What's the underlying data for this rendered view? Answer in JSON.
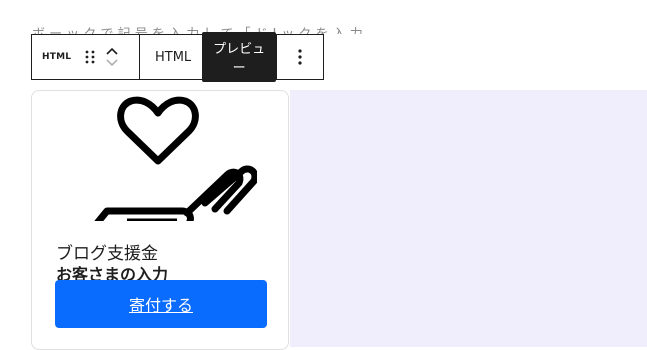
{
  "background": {
    "faded_text": "ボ ー ッ ク で 記 号 を 入 力 し て 「 ド ! ッ ク を 入 力"
  },
  "toolbar": {
    "block_type_label": "HTML",
    "tab_html": "HTML",
    "tab_preview": "プレビュー",
    "icons": [
      "drag-handle-icon",
      "chevron-up-icon",
      "chevron-down-icon",
      "more-vertical-icon"
    ]
  },
  "card": {
    "subtitle": "ブログ支援金",
    "title": "お客さまの入力",
    "button_label": "寄付する",
    "icon": "heart-hand-icon"
  },
  "colors": {
    "button": "#0a6cff",
    "preview_bg": "#f0eefc",
    "active_tab": "#1e1e1e"
  }
}
